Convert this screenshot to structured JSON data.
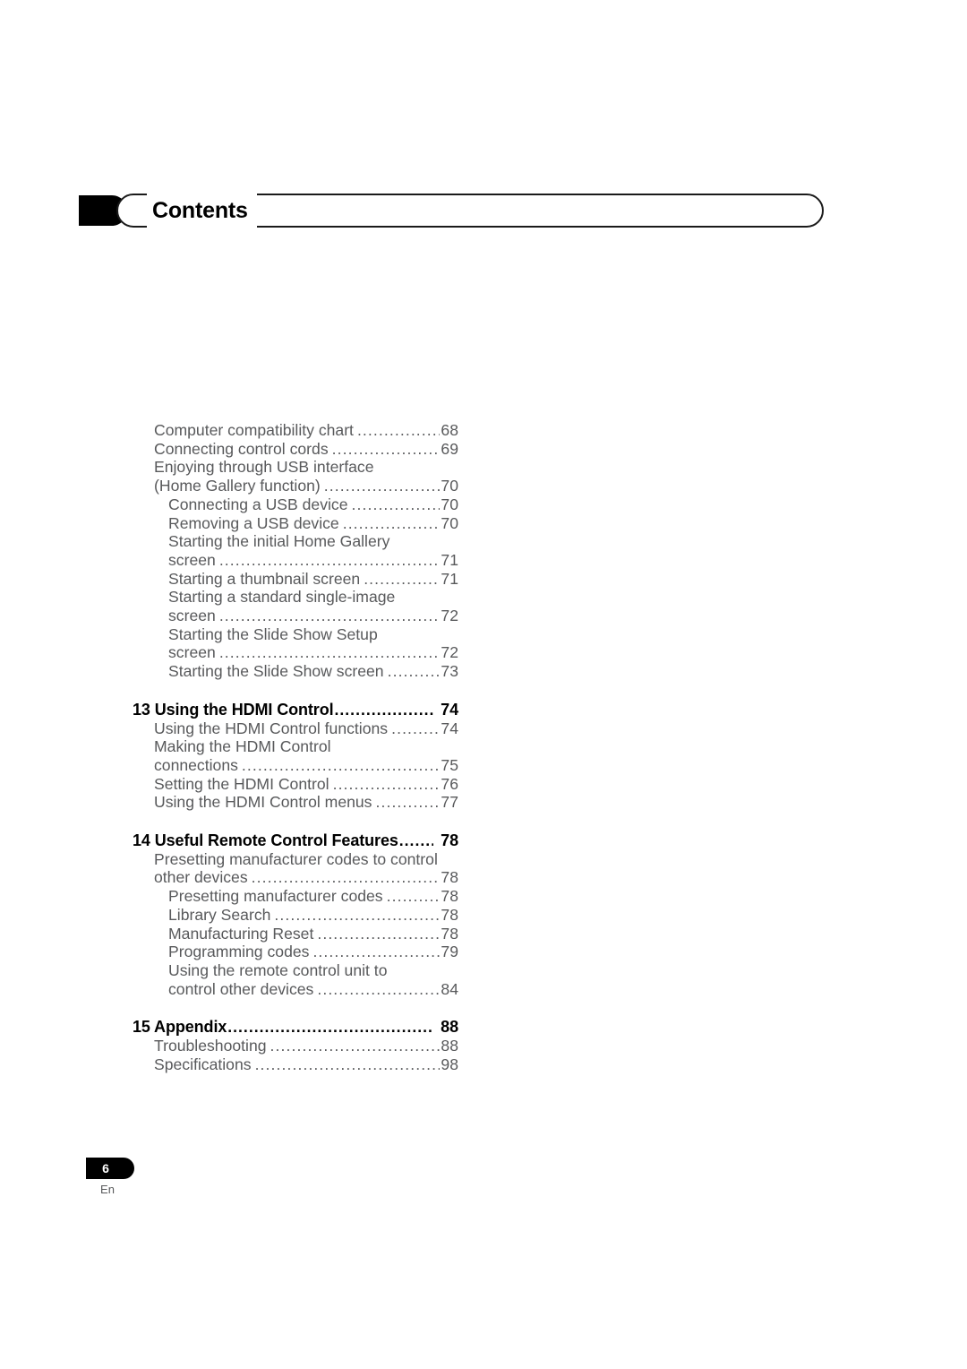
{
  "header": {
    "title": "Contents"
  },
  "footer": {
    "page_number": "6",
    "language": "En"
  },
  "leader_char": "...............................................................................",
  "toc": {
    "groups": [
      {
        "heading": null,
        "entries": [
          {
            "level": 1,
            "text": "Computer compatibility chart",
            "page": "68",
            "lines": [
              "Computer compatibility chart"
            ]
          },
          {
            "level": 1,
            "text": "Connecting control cords",
            "page": "69",
            "lines": [
              "Connecting control cords"
            ]
          },
          {
            "level": 1,
            "text": "Enjoying through USB interface (Home Gallery function)",
            "page": "70",
            "lines": [
              "Enjoying through USB interface",
              "(Home Gallery function)"
            ]
          },
          {
            "level": 2,
            "text": "Connecting a USB device",
            "page": "70",
            "lines": [
              "Connecting a USB device"
            ]
          },
          {
            "level": 2,
            "text": "Removing a USB device",
            "page": "70",
            "lines": [
              "Removing a USB device"
            ]
          },
          {
            "level": 2,
            "text": "Starting the initial Home Gallery screen",
            "page": "71",
            "lines": [
              "Starting the initial Home Gallery",
              "screen"
            ]
          },
          {
            "level": 2,
            "text": "Starting a thumbnail screen",
            "page": "71",
            "lines": [
              "Starting a thumbnail screen"
            ]
          },
          {
            "level": 2,
            "text": "Starting a standard single-image screen",
            "page": "72",
            "lines": [
              "Starting a standard single-image",
              "screen"
            ]
          },
          {
            "level": 2,
            "text": "Starting the Slide Show Setup screen",
            "page": "72",
            "lines": [
              "Starting the Slide Show Setup",
              "screen"
            ]
          },
          {
            "level": 2,
            "text": "Starting the Slide Show screen",
            "page": "73",
            "lines": [
              "Starting the Slide Show screen"
            ]
          }
        ]
      },
      {
        "heading": {
          "number": "13",
          "title": "Using the HDMI Control",
          "page": "74"
        },
        "entries": [
          {
            "level": 1,
            "text": "Using the HDMI Control functions",
            "page": "74",
            "lines": [
              "Using the HDMI Control functions"
            ]
          },
          {
            "level": 1,
            "text": "Making the HDMI Control connections",
            "page": "75",
            "lines": [
              "Making the HDMI Control",
              "connections"
            ]
          },
          {
            "level": 1,
            "text": "Setting the HDMI Control",
            "page": "76",
            "lines": [
              "Setting the HDMI Control"
            ]
          },
          {
            "level": 1,
            "text": "Using the HDMI Control menus",
            "page": "77",
            "lines": [
              "Using the HDMI Control menus"
            ]
          }
        ]
      },
      {
        "heading": {
          "number": "14",
          "title": "Useful Remote Control Features",
          "page": "78"
        },
        "entries": [
          {
            "level": 1,
            "text": "Presetting manufacturer codes to control other devices",
            "page": "78",
            "lines": [
              "Presetting manufacturer codes to control",
              "other devices"
            ]
          },
          {
            "level": 2,
            "text": "Presetting manufacturer codes",
            "page": "78",
            "lines": [
              "Presetting manufacturer codes"
            ]
          },
          {
            "level": 2,
            "text": "Library Search",
            "page": "78",
            "lines": [
              "Library Search"
            ]
          },
          {
            "level": 2,
            "text": "Manufacturing Reset",
            "page": "78",
            "lines": [
              "Manufacturing Reset"
            ]
          },
          {
            "level": 2,
            "text": "Programming  codes",
            "page": "79",
            "lines": [
              "Programming  codes"
            ]
          },
          {
            "level": 2,
            "text": "Using the remote control unit to control other devices",
            "page": "84",
            "lines": [
              "Using the remote control unit to",
              "control other devices"
            ]
          }
        ]
      },
      {
        "heading": {
          "number": "15",
          "title": "Appendix",
          "page": "88"
        },
        "entries": [
          {
            "level": 1,
            "text": "Troubleshooting",
            "page": "88",
            "lines": [
              "Troubleshooting"
            ]
          },
          {
            "level": 1,
            "text": "Specifications",
            "page": "98",
            "lines": [
              "Specifications"
            ]
          }
        ]
      }
    ]
  }
}
